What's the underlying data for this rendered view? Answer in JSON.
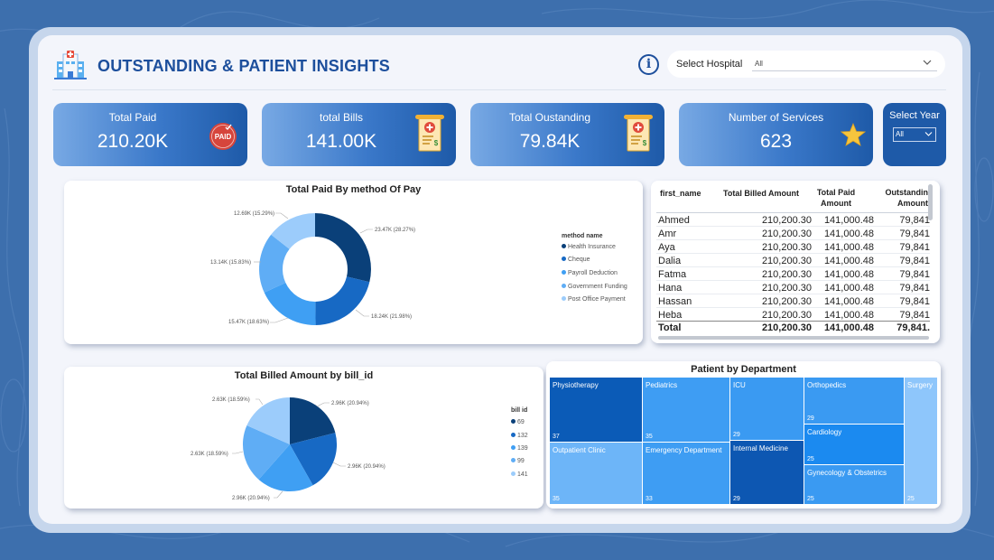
{
  "header": {
    "title": "OUTSTANDING & PATIENT INSIGHTS",
    "info_icon": "info-icon",
    "hospital_label": "Select Hospital",
    "hospital_value": "All"
  },
  "kpis": [
    {
      "label": "Total Paid",
      "value": "210.20K",
      "icon": "paid-stamp-icon"
    },
    {
      "label": "total Bills",
      "value": "141.00K",
      "icon": "bill-receipt-icon"
    },
    {
      "label": "Total Oustanding",
      "value": "79.84K",
      "icon": "bill-receipt-icon"
    },
    {
      "label": "Number of Services",
      "value": "623",
      "icon": "star-icon"
    }
  ],
  "year_filter": {
    "label": "Select Year",
    "value": "All"
  },
  "paid_stamp_text": "PAID",
  "colors": {
    "primary": "#1d4f9c",
    "series": [
      "#0a4079",
      "#1769c4",
      "#3f9ff3",
      "#5fadf5",
      "#9cccfb"
    ]
  },
  "donut_chart": {
    "title": "Total Paid By method Of Pay",
    "legend_title": "method name",
    "legend": [
      "Health Insurance",
      "Cheque",
      "Payroll Deduction",
      "Government Funding",
      "Post Office Payment"
    ],
    "data_labels": [
      "23.47K (28.27%)",
      "18.24K (21.98%)",
      "15.47K (18.63%)",
      "13.14K (15.83%)",
      "12.69K (15.29%)"
    ]
  },
  "pie_chart": {
    "title": "Total Billed Amount by bill_id",
    "legend_title": "bill id",
    "legend": [
      "69",
      "132",
      "139",
      "99",
      "141"
    ],
    "data_labels": [
      "2.96K (20.94%)",
      "2.96K (20.94%)",
      "2.96K (20.94%)",
      "2.63K (18.59%)",
      "2.63K (18.59%)"
    ]
  },
  "table": {
    "headers": {
      "first_name": "first_name",
      "billed": "Total Billed Amount",
      "paid_1": "Total Paid",
      "paid_2": "Amount",
      "out_1": "Outstandin",
      "out_2": "Amount"
    },
    "rows": [
      {
        "name": "Ahmed",
        "billed": "210,200.30",
        "paid": "141,000.48",
        "out": "79,841"
      },
      {
        "name": "Amr",
        "billed": "210,200.30",
        "paid": "141,000.48",
        "out": "79,841"
      },
      {
        "name": "Aya",
        "billed": "210,200.30",
        "paid": "141,000.48",
        "out": "79,841"
      },
      {
        "name": "Dalia",
        "billed": "210,200.30",
        "paid": "141,000.48",
        "out": "79,841"
      },
      {
        "name": "Fatma",
        "billed": "210,200.30",
        "paid": "141,000.48",
        "out": "79,841"
      },
      {
        "name": "Hana",
        "billed": "210,200.30",
        "paid": "141,000.48",
        "out": "79,841"
      },
      {
        "name": "Hassan",
        "billed": "210,200.30",
        "paid": "141,000.48",
        "out": "79,841"
      },
      {
        "name": "Heba",
        "billed": "210,200.30",
        "paid": "141,000.48",
        "out": "79,841"
      }
    ],
    "total": {
      "name": "Total",
      "billed": "210,200.30",
      "paid": "141,000.48",
      "out": "79,841."
    }
  },
  "treemap": {
    "title": "Patient by Department",
    "tiles": [
      {
        "name": "Physiotherapy",
        "value": "37",
        "color": "#0b5bb7"
      },
      {
        "name": "Pediatrics",
        "value": "35",
        "color": "#3e9df3"
      },
      {
        "name": "ICU",
        "value": "29",
        "color": "#3a9af2"
      },
      {
        "name": "Orthopedics",
        "value": "29",
        "color": "#3a9af2"
      },
      {
        "name": "Surgery",
        "value": "25",
        "color": "#8ec6fb"
      },
      {
        "name": "Cardiology",
        "value": "25",
        "color": "#1b8af0"
      },
      {
        "name": "Gynecology & Obstetrics",
        "value": "25",
        "color": "#3a9af2"
      },
      {
        "name": "Outpatient Clinic",
        "value": "35",
        "color": "#6db5f8"
      },
      {
        "name": "Emergency Department",
        "value": "33",
        "color": "#3e9df3"
      },
      {
        "name": "Internal Medicine",
        "value": "29",
        "color": "#0d57b2"
      }
    ]
  }
}
